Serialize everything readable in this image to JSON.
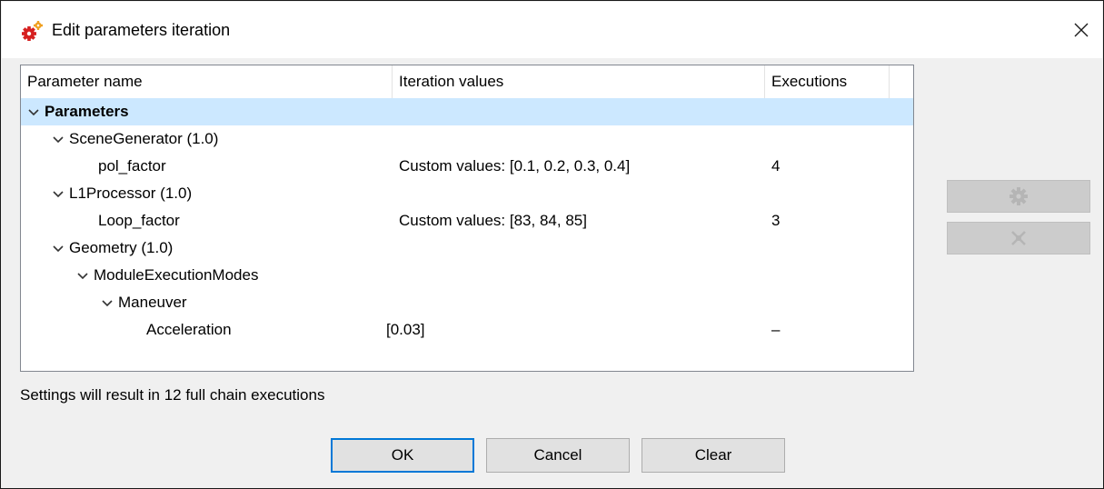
{
  "window": {
    "title": "Edit parameters iteration",
    "icon": "gears-icon",
    "close_glyph": "×"
  },
  "tree": {
    "columns": [
      "Parameter name",
      "Iteration values",
      "Executions"
    ],
    "rows": [
      {
        "name": "Parameters",
        "values": "",
        "executions": "",
        "expanded": true,
        "bold": true,
        "selected": true
      },
      {
        "name": "SceneGenerator (1.0)",
        "values": "",
        "executions": "",
        "expanded": true
      },
      {
        "name": "pol_factor",
        "values": "Custom values: [0.1, 0.2, 0.3, 0.4]",
        "executions": "4"
      },
      {
        "name": "L1Processor (1.0)",
        "values": "",
        "executions": "",
        "expanded": true
      },
      {
        "name": "Loop_factor",
        "values": "Custom values: [83, 84, 85]",
        "executions": "3"
      },
      {
        "name": "Geometry (1.0)",
        "values": "",
        "executions": "",
        "expanded": true
      },
      {
        "name": "ModuleExecutionModes",
        "values": "",
        "executions": "",
        "expanded": true
      },
      {
        "name": "Maneuver",
        "values": "",
        "executions": "",
        "expanded": true
      },
      {
        "name": "Acceleration",
        "values": "[0.03]",
        "executions": "–"
      }
    ]
  },
  "side_buttons": [
    {
      "icon": "gear-icon",
      "enabled": false
    },
    {
      "icon": "clear-icon",
      "enabled": false
    }
  ],
  "status_text": "Settings will result in 12 full chain executions",
  "buttons": {
    "ok": "OK",
    "cancel": "Cancel",
    "clear": "Clear"
  },
  "colors": {
    "selection": "#cce8ff",
    "default_button_border": "#0078d7",
    "disabled_button": "#cccccc"
  }
}
